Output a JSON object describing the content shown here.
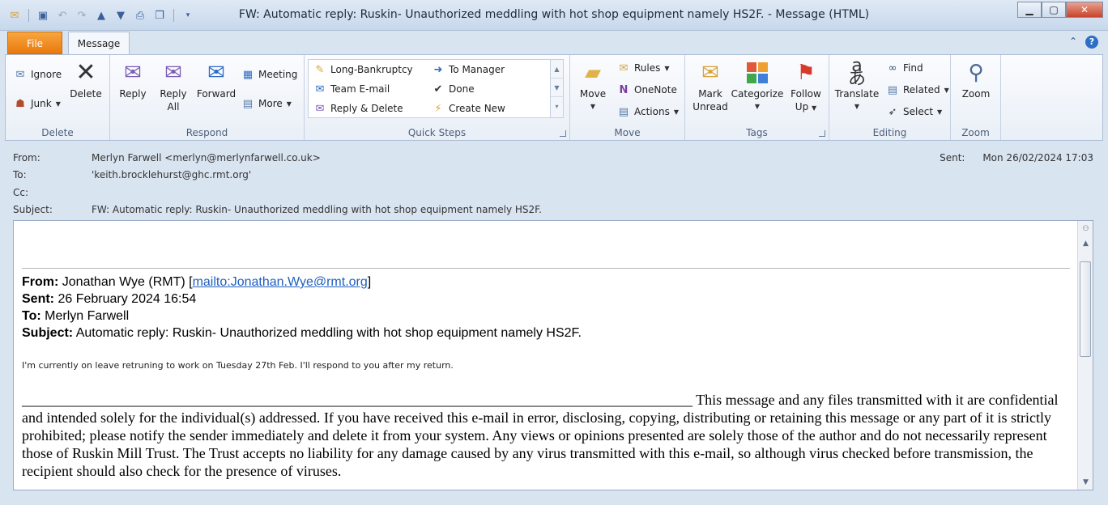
{
  "window": {
    "title": "FW: Automatic reply: Ruskin- Unauthorized meddling with hot shop equipment namely HS2F.  -  Message (HTML)"
  },
  "tabs": {
    "file": "File",
    "message": "Message"
  },
  "ribbon": {
    "delete_group": {
      "label": "Delete",
      "ignore": "Ignore",
      "junk": "Junk",
      "delete": "Delete"
    },
    "respond_group": {
      "label": "Respond",
      "reply": "Reply",
      "reply_all_1": "Reply",
      "reply_all_2": "All",
      "forward": "Forward",
      "meeting": "Meeting",
      "more": "More"
    },
    "quicksteps_group": {
      "label": "Quick Steps",
      "items": [
        "Long-Bankruptcy",
        "To Manager",
        "Team E-mail",
        "Done",
        "Reply & Delete",
        "Create New"
      ]
    },
    "move_group": {
      "label": "Move",
      "move": "Move",
      "rules": "Rules",
      "onenote": "OneNote",
      "actions": "Actions"
    },
    "tags_group": {
      "label": "Tags",
      "mark_1": "Mark",
      "mark_2": "Unread",
      "categorize": "Categorize",
      "follow_1": "Follow",
      "follow_2": "Up"
    },
    "editing_group": {
      "label": "Editing",
      "translate": "Translate",
      "find": "Find",
      "related": "Related",
      "select": "Select"
    },
    "zoom_group": {
      "label": "Zoom",
      "zoom": "Zoom"
    }
  },
  "header": {
    "from_label": "From:",
    "from": "Merlyn Farwell <merlyn@merlynfarwell.co.uk>",
    "to_label": "To:",
    "to": "'keith.brocklehurst@ghc.rmt.org'",
    "cc_label": "Cc:",
    "cc": "",
    "subject_label": "Subject:",
    "subject": "FW: Automatic reply: Ruskin- Unauthorized meddling with hot shop equipment namely HS2F.",
    "sent_label": "Sent:",
    "sent": "Mon 26/02/2024 17:03"
  },
  "body": {
    "fwd_from_label": "From:",
    "fwd_from": "Jonathan Wye (RMT) [",
    "fwd_from_link": "mailto:Jonathan.Wye@rmt.org",
    "fwd_from_end": "]",
    "fwd_sent_label": "Sent:",
    "fwd_sent": "26 February 2024 16:54",
    "fwd_to_label": "To:",
    "fwd_to": "Merlyn Farwell",
    "fwd_subject_label": "Subject:",
    "fwd_subject": "Automatic reply: Ruskin- Unauthorized meddling with hot shop equipment namely HS2F.",
    "auto_reply": "I'm currently on leave retruning to work on Tuesday 27th Feb. I'll respond to you after my return.",
    "disclaimer_line": "____________________________________________________________________________________________",
    "disclaimer": " This message and any files transmitted with it are confidential and intended solely for the individual(s) addressed. If you have received this e-mail in error, disclosing, copying, distributing or retaining this message or any part of it is strictly prohibited; please notify the sender immediately and delete it from your system. Any views or opinions presented are solely those of the author and do not necessarily represent those of Ruskin Mill Trust. The Trust accepts no liability for any damage caused by any virus transmitted with this e-mail, so although virus checked before transmission, the recipient should also check for the presence of viruses."
  }
}
